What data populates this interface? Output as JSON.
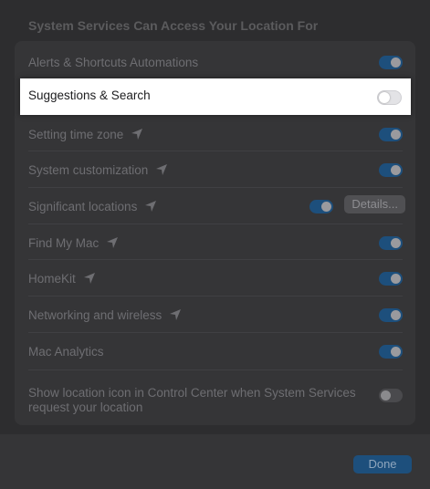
{
  "header": {
    "title": "System Services Can Access Your Location For"
  },
  "rows": [
    {
      "label": "Alerts & Shortcuts Automations",
      "toggle": "on"
    },
    {
      "label": "Suggestions & Search",
      "toggle": "off"
    },
    {
      "label": "Setting time zone",
      "toggle": "on",
      "icon": "location-arrow-icon"
    },
    {
      "label": "System customization",
      "toggle": "on",
      "icon": "location-arrow-icon"
    },
    {
      "label": "Significant locations",
      "toggle": "on",
      "icon": "location-arrow-icon",
      "button": "Details..."
    },
    {
      "label": "Find My Mac",
      "toggle": "on",
      "icon": "location-arrow-icon"
    },
    {
      "label": "HomeKit",
      "toggle": "on",
      "icon": "location-arrow-icon"
    },
    {
      "label": "Networking and wireless",
      "toggle": "on",
      "icon": "location-arrow-icon"
    },
    {
      "label": "Mac Analytics",
      "toggle": "on"
    },
    {
      "label_line1": "Show location icon in Control Center when System Services",
      "label_line2": "request your location",
      "toggle": "off"
    }
  ],
  "footer": {
    "done_label": "Done"
  },
  "colors": {
    "accent": "#1d4f7c",
    "highlight_bg": "#ffffff"
  }
}
